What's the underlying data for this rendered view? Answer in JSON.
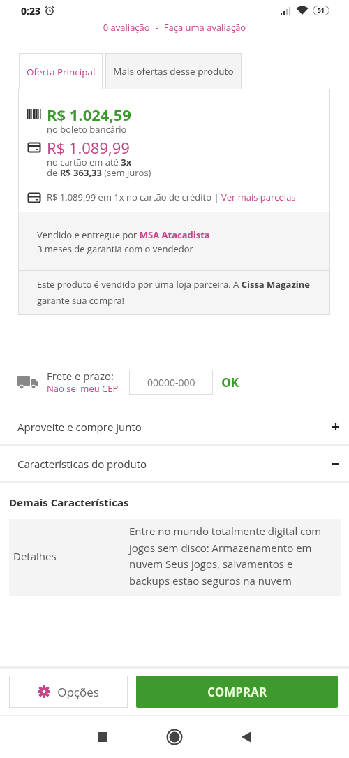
{
  "status_bar": {
    "time": "0:23",
    "battery": "51"
  },
  "reviews": {
    "count": "0 avaliação",
    "separator": "-",
    "link": "Faça uma avaliação"
  },
  "tabs": [
    {
      "label": "Oferta Principal",
      "selected": true
    },
    {
      "label": "Mais ofertas desse produto",
      "selected": false
    }
  ],
  "offer": {
    "boleto_price": "R$ 1.024,59",
    "boleto_note": "no boleto bancário",
    "card_price": "R$ 1.089,99",
    "card_note": "no cartão em até **3x**",
    "card_installment": "de **R$ 363,33** (sem juros)",
    "credit_text": "R$ 1.089,99 em 1x no cartão de crédito |",
    "credit_link": "Ver mais parcelas"
  },
  "seller": {
    "prefix": "Vendido e entregue por",
    "name": "MSA Atacadista",
    "warranty": "3 meses de garantia com o vendedor",
    "partner_note": "Este produto é vendido por uma loja parceira. A **Cissa Magazine** garante sua compra!"
  },
  "shipping": {
    "label": "Frete e prazo:",
    "link": "Não sei meu CEP",
    "placeholder": "00000-000",
    "button": "OK"
  },
  "accordion": [
    {
      "title": "Aproveite e compre junto",
      "expanded": false
    },
    {
      "title": "Características do produto",
      "expanded": true
    }
  ],
  "specs": {
    "heading": "Demais Características",
    "rows": [
      {
        "name": "Detalhes",
        "value": "Entre no mundo totalmente digital com jogos sem disco: Armazenamento em nuvem Seus jogos, salvamentos e backups estão seguros na nuvem"
      }
    ]
  },
  "bottom_bar": {
    "options": "Opções",
    "buy": "COMPRAR"
  }
}
